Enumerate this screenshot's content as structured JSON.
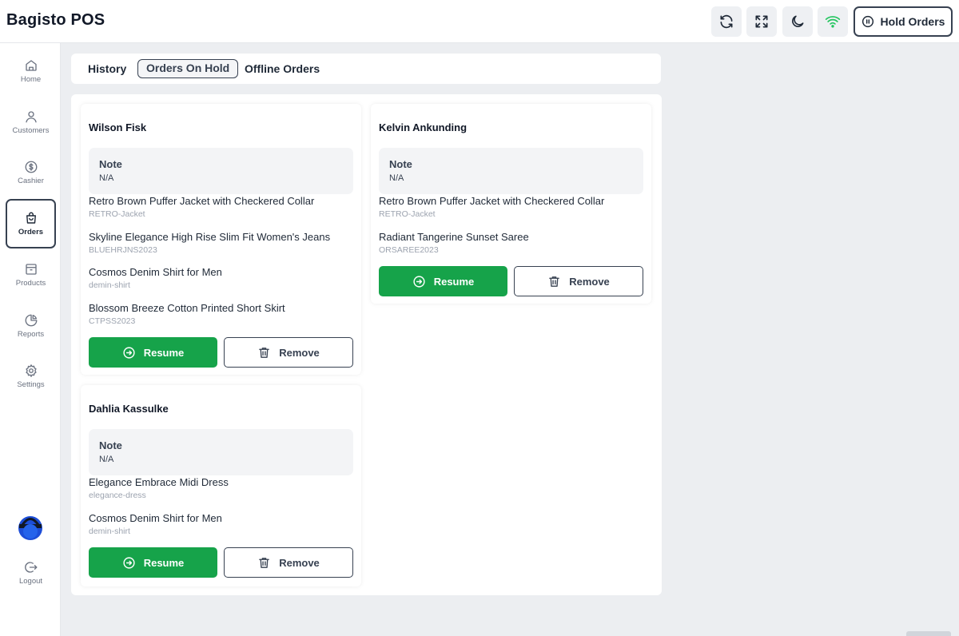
{
  "app": {
    "title": "Bagisto POS"
  },
  "header": {
    "hold_orders_label": "Hold Orders",
    "icons": [
      "refresh-icon",
      "fullscreen-icon",
      "moon-icon",
      "wifi-icon"
    ],
    "wifi_color": "#22c55e"
  },
  "sidebar": {
    "items": [
      {
        "label": "Home",
        "icon": "home-icon"
      },
      {
        "label": "Customers",
        "icon": "user-icon"
      },
      {
        "label": "Cashier",
        "icon": "dollar-icon"
      },
      {
        "label": "Orders",
        "icon": "shopping-bag-icon",
        "active": true
      },
      {
        "label": "Products",
        "icon": "box-icon"
      },
      {
        "label": "Reports",
        "icon": "pie-chart-icon"
      },
      {
        "label": "Settings",
        "icon": "gear-icon"
      }
    ],
    "logout_label": "Logout"
  },
  "tabs": [
    {
      "label": "History"
    },
    {
      "label": "Orders On Hold",
      "active": true
    },
    {
      "label": "Offline Orders"
    }
  ],
  "orders": [
    {
      "customer": "Wilson Fisk",
      "note_title": "Note",
      "note_value": "N/A",
      "items": [
        {
          "name": "Retro Brown Puffer Jacket with Checkered Collar",
          "sku": "RETRO-Jacket"
        },
        {
          "name": "Skyline Elegance High Rise Slim Fit Women's Jeans",
          "sku": "BLUEHRJNS2023"
        },
        {
          "name": "Cosmos Denim Shirt for Men",
          "sku": "demin-shirt"
        },
        {
          "name": "Blossom Breeze Cotton Printed Short Skirt",
          "sku": "CTPSS2023"
        }
      ],
      "resume_label": "Resume",
      "remove_label": "Remove"
    },
    {
      "customer": "Kelvin Ankunding",
      "note_title": "Note",
      "note_value": "N/A",
      "items": [
        {
          "name": "Retro Brown Puffer Jacket with Checkered Collar",
          "sku": "RETRO-Jacket"
        },
        {
          "name": "Radiant Tangerine Sunset Saree",
          "sku": "ORSAREE2023"
        }
      ],
      "resume_label": "Resume",
      "remove_label": "Remove"
    },
    {
      "customer": "Dahlia Kassulke",
      "note_title": "Note",
      "note_value": "N/A",
      "items": [
        {
          "name": "Elegance Embrace Midi Dress",
          "sku": "elegance-dress"
        },
        {
          "name": "Cosmos Denim Shirt for Men",
          "sku": "demin-shirt"
        }
      ],
      "resume_label": "Resume",
      "remove_label": "Remove"
    }
  ],
  "colors": {
    "accent_green": "#16a34a",
    "border_dark": "#374151",
    "page_background": "#eceef1",
    "avatar_blue": "#1d4ed8"
  }
}
